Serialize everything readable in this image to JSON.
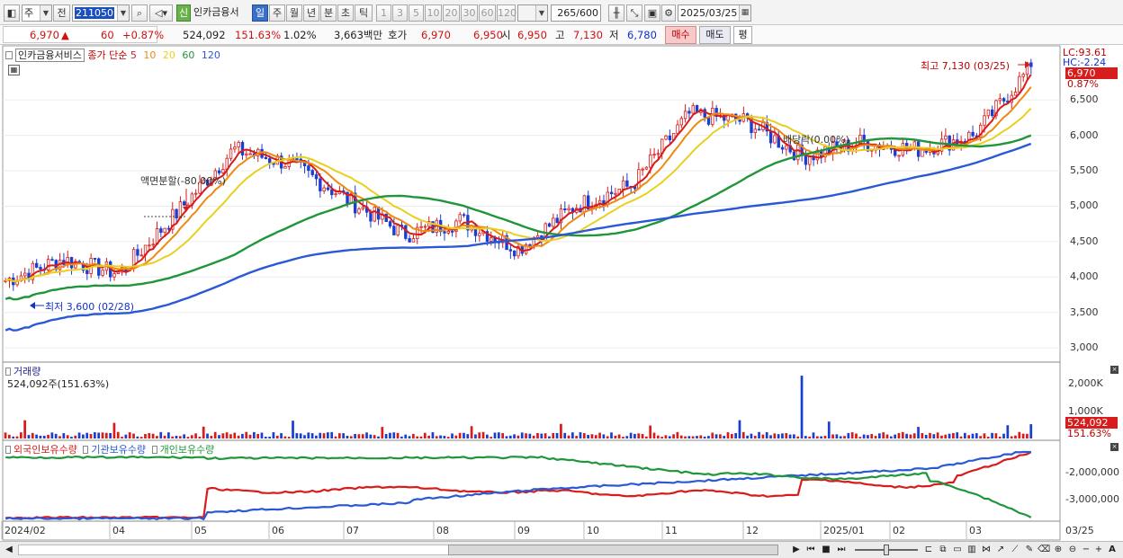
{
  "toolbar": {
    "period_prefix": "주",
    "prev_label": "전",
    "code": "211050",
    "stock_badge": "신",
    "stock_name": "인카금융서",
    "periods": [
      "일",
      "주",
      "월",
      "년",
      "분",
      "초",
      "틱"
    ],
    "selected_period": "일",
    "intervals": [
      "1",
      "3",
      "5",
      "10",
      "20",
      "30",
      "60",
      "120"
    ],
    "count": "265",
    "count_total": "/600",
    "date": "2025/03/25"
  },
  "quote": {
    "price": "6,970",
    "arrow": "▲",
    "change": "60",
    "change_pct": "+0.87%",
    "volume": "524,092",
    "volume_ratio": "151.63%",
    "turnover": "1.02%",
    "amount": "3,663백만",
    "label_hoga": "호가",
    "ask": "6,970",
    "bid": "6,950",
    "label_open": "시",
    "open": "6,950",
    "label_high": "고",
    "high": "7,130",
    "label_low": "저",
    "low": "6,780",
    "buy_label": "매수",
    "sell_label": "매도",
    "eval_label": "평"
  },
  "legend": {
    "stock": "인카금융서비스",
    "ma_label": "종가 단순",
    "ma_periods": [
      "5",
      "10",
      "20",
      "60",
      "120"
    ],
    "ma_colors": [
      "#d81b1b",
      "#ee8a10",
      "#e8d020",
      "#20963a",
      "#2a58d6"
    ],
    "volume_label": "거래량",
    "volume_value": "524,092주(151.63%)",
    "holdings": [
      "외국인보유수량",
      "기관보유수량",
      "개인보유수량"
    ],
    "holding_colors": [
      "#d81b1b",
      "#2a58d6",
      "#20963a"
    ]
  },
  "annotations": {
    "high": "최고 7,130 (03/25)",
    "low": "최저 3,600 (02/28)",
    "split": "액면분할(-80.00%)",
    "dividend": "배당락(0.00%)"
  },
  "price_axis": {
    "ticks": [
      "6,500",
      "6,000",
      "5,500",
      "5,000",
      "4,500",
      "4,000",
      "3,500",
      "3,000"
    ],
    "lc": "LC:93.61",
    "hc": "HC:-2.24",
    "last": "6,970",
    "last_pct": "0.87%"
  },
  "volume_axis": {
    "ticks": [
      "2,000K",
      "1,000K"
    ],
    "last": "524,092",
    "last_pct": "151.63%"
  },
  "holdings_axis": {
    "ticks": [
      "-2,000,000",
      "-3,000,000"
    ]
  },
  "date_axis": {
    "labels": [
      "2024/02",
      "04",
      "05",
      "06",
      "07",
      "08",
      "09",
      "10",
      "11",
      "12",
      "2025/01",
      "02",
      "03",
      "03/25"
    ]
  },
  "chart_data": [
    {
      "type": "candlestick",
      "title": "인카금융서비스",
      "x": [
        "2024/02",
        "04",
        "05",
        "06",
        "07",
        "08",
        "09",
        "10",
        "11",
        "12",
        "2025/01",
        "02",
        "03",
        "03/25"
      ],
      "close_approx": [
        3950,
        4250,
        4050,
        4900,
        5800,
        5600,
        5100,
        4600,
        4800,
        4400,
        5000,
        5300,
        6300,
        6200,
        5700,
        5900,
        5800,
        6000,
        6970
      ],
      "series": [
        {
          "name": "5",
          "color": "#d81b1b"
        },
        {
          "name": "10",
          "color": "#ee8a10"
        },
        {
          "name": "20",
          "color": "#e8d020"
        },
        {
          "name": "60",
          "color": "#20963a"
        },
        {
          "name": "120",
          "color": "#2a58d6"
        }
      ],
      "ylim": [
        2900,
        7200
      ],
      "high": 7130,
      "low": 3600
    },
    {
      "type": "bar",
      "title": "거래량",
      "last": 524092,
      "max_approx": 2300000,
      "ylim": [
        0,
        2500000
      ]
    },
    {
      "type": "line",
      "series": [
        {
          "name": "외국인보유수량",
          "color": "#d81b1b"
        },
        {
          "name": "기관보유수량",
          "color": "#2a58d6"
        },
        {
          "name": "개인보유수량",
          "color": "#20963a"
        }
      ]
    }
  ]
}
